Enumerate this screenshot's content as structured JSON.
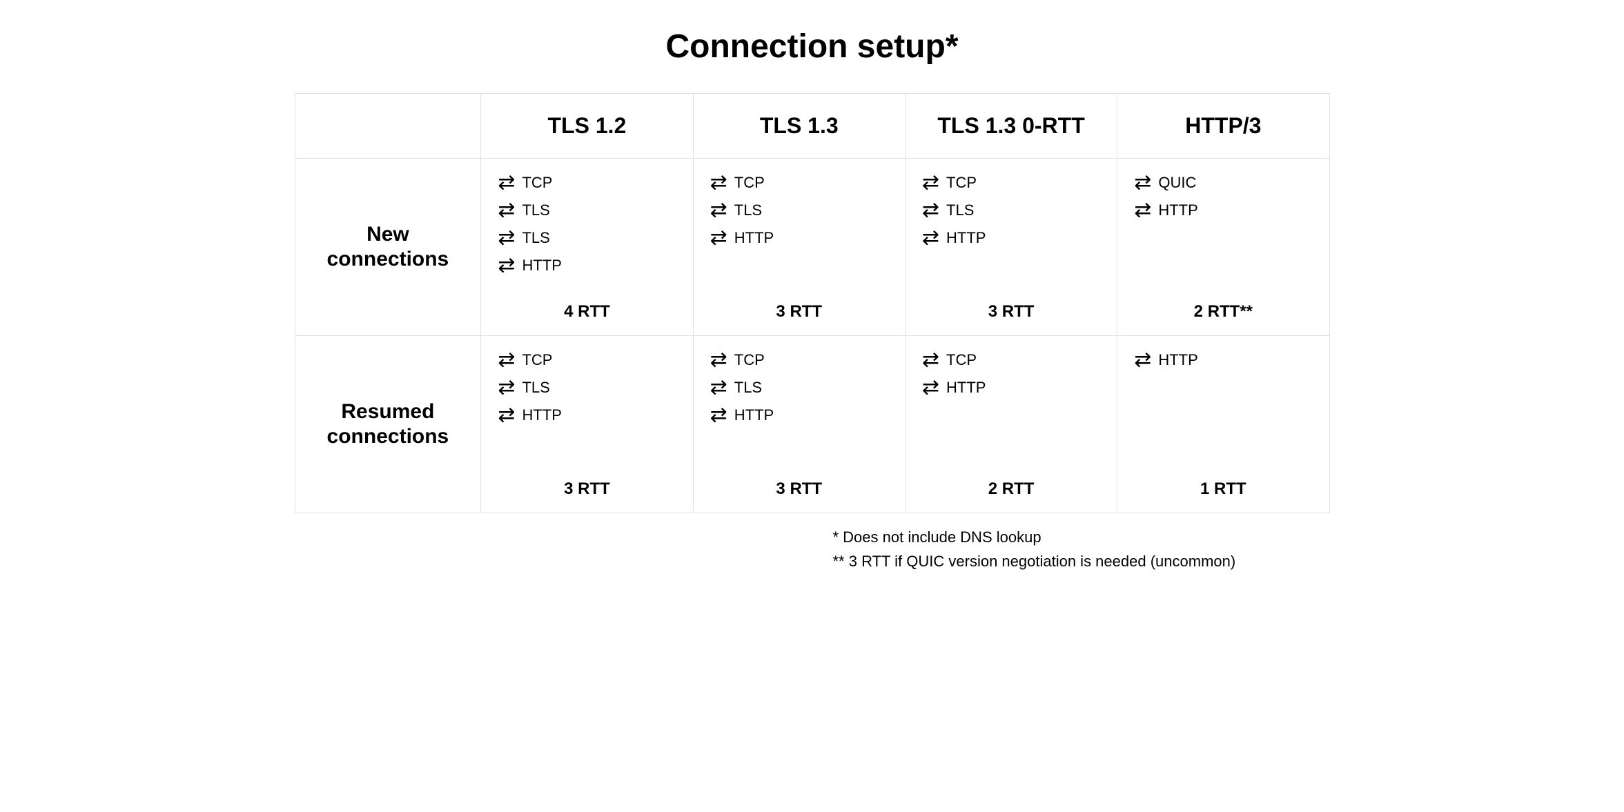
{
  "title": "Connection setup*",
  "headers": {
    "col1": "TLS 1.2",
    "col2": "TLS 1.3",
    "col3": "TLS 1.3 0-RTT",
    "col4": "HTTP/3"
  },
  "rows": {
    "new": {
      "label": "New connections",
      "cells": {
        "c1": {
          "steps": [
            "TCP",
            "TLS",
            "TLS",
            "HTTP"
          ],
          "rtt": "4 RTT"
        },
        "c2": {
          "steps": [
            "TCP",
            "TLS",
            "HTTP"
          ],
          "rtt": "3 RTT"
        },
        "c3": {
          "steps": [
            "TCP",
            "TLS",
            "HTTP"
          ],
          "rtt": "3 RTT"
        },
        "c4": {
          "steps": [
            "QUIC",
            "HTTP"
          ],
          "rtt": "2 RTT**"
        }
      }
    },
    "resumed": {
      "label": "Resumed connections",
      "cells": {
        "c1": {
          "steps": [
            "TCP",
            "TLS",
            "HTTP"
          ],
          "rtt": "3 RTT"
        },
        "c2": {
          "steps": [
            "TCP",
            "TLS",
            "HTTP"
          ],
          "rtt": "3 RTT"
        },
        "c3": {
          "steps": [
            "TCP",
            "HTTP"
          ],
          "rtt": "2 RTT"
        },
        "c4": {
          "steps": [
            "HTTP"
          ],
          "rtt": "1 RTT"
        }
      }
    }
  },
  "footnotes": {
    "f1": "* Does not include DNS lookup",
    "f2": "** 3 RTT if QUIC version negotiation is needed (uncommon)"
  },
  "arrow_glyph": "⇄"
}
